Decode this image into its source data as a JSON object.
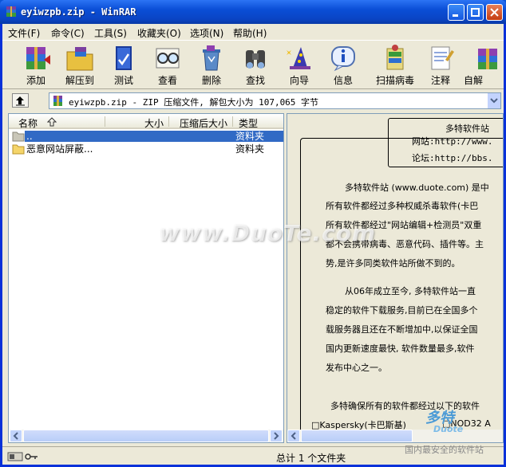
{
  "window": {
    "title": "eyiwzpb.zip - WinRAR"
  },
  "menu": [
    "文件(F)",
    "命令(C)",
    "工具(S)",
    "收藏夹(O)",
    "选项(N)",
    "帮助(H)"
  ],
  "toolbar": [
    "添加",
    "解压到",
    "测试",
    "查看",
    "删除",
    "查找",
    "向导",
    "信息",
    "扫描病毒",
    "注释",
    "自解"
  ],
  "address": {
    "text": "eyiwzpb.zip - ZIP 压缩文件, 解包大小为 107,065 字节"
  },
  "columns": {
    "name": "名称",
    "size": "大小",
    "packed": "压缩后大小",
    "type": "类型"
  },
  "files": [
    {
      "name": "..",
      "type": "资料夹"
    },
    {
      "name": "恶意网站屏蔽...",
      "type": "资料夹"
    }
  ],
  "viewer": {
    "header_line1": "多特软件站",
    "header_line2": "网站:http://www.",
    "header_line3": "论坛:http://bbs.",
    "p1": [
      "多特软件站 (www.duote.com) 是中",
      "所有软件都经过多种权威杀毒软件(卡巴",
      "所有软件都经过\"网站编辑+检测员\"双重",
      "都不会携带病毒、恶意代码、插件等。主",
      "势,是许多同类软件站所做不到的。"
    ],
    "p2": [
      "从06年成立至今, 多特软件站一直",
      "稳定的软件下载服务,目前已在全国多个",
      "载服务器且还在不断增加中,以保证全国",
      "国内更新速度最快, 软件数量最多,软件",
      "发布中心之一。"
    ],
    "p3": "多特确保所有的软件都经过以下的软件",
    "p4a": "□Kaspersky(卡巴斯基)",
    "p4b": "□NOD32 A"
  },
  "status": {
    "text": "总计 1 个文件夹"
  },
  "watermark": "www.DuoTe.com",
  "logo": {
    "line1": "多特",
    "line2": "Duote",
    "line3": "国内最安全的软件站"
  },
  "colors": {
    "title_bar": "#0a4ed6",
    "selection": "#316ac5"
  }
}
